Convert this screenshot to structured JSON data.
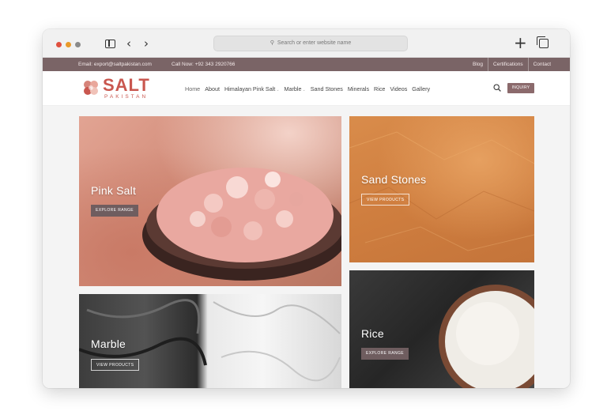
{
  "browser": {
    "address_placeholder": "Search or enter website name"
  },
  "topbar": {
    "email": "Email: export@saltpakistan.com",
    "call": "Call Now: +92 343 2920766",
    "links": [
      "Blog",
      "Certifications",
      "Contact"
    ]
  },
  "header": {
    "logo_text": "SALT",
    "logo_sub": "PAKISTAN",
    "nav": [
      {
        "label": "Home",
        "dropdown": false
      },
      {
        "label": "About",
        "dropdown": false
      },
      {
        "label": "Himalayan Pink Salt",
        "dropdown": true
      },
      {
        "label": "Marble",
        "dropdown": true
      },
      {
        "label": "Sand Stones",
        "dropdown": false
      },
      {
        "label": "Minerals",
        "dropdown": false
      },
      {
        "label": "Rice",
        "dropdown": false
      },
      {
        "label": "Videos",
        "dropdown": false
      },
      {
        "label": "Gallery",
        "dropdown": false
      }
    ],
    "inquiry_label": "INQUIRY"
  },
  "tiles": {
    "pink_salt": {
      "title": "Pink Salt",
      "cta": "EXPLORE RANGE"
    },
    "sand_stones": {
      "title": "Sand Stones",
      "cta": "VIEW PRODUCTS"
    },
    "marble": {
      "title": "Marble",
      "cta": "VIEW PRODUCTS"
    },
    "rice": {
      "title": "Rice",
      "cta": "EXPLORE RANGE"
    }
  },
  "colors": {
    "topbar_bg": "#7a6466",
    "brand": "#c9574f",
    "inquiry_bg": "#8b6a6c"
  }
}
